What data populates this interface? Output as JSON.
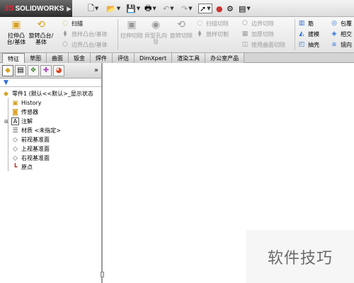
{
  "app": {
    "logo_text": "SOLIDWORKS",
    "logo_mark": "3S"
  },
  "ribbon": {
    "extrude_boss": "拉伸凸台/基体",
    "revolve_boss": "旋转凸台/基体",
    "sweep": "扫描",
    "loft": "放样凸台/基体",
    "boundary_boss": "边界凸台/基体",
    "extrude_cut": "拉伸切除",
    "hole_wizard": "异型孔向导",
    "revolve_cut": "旋转切除",
    "swept_cut": "扫描切除",
    "lofted_cut": "放样切割",
    "boundary_cut": "边界切除",
    "thicken_cut": "加厚切除",
    "surface_cut": "使用曲面切除",
    "rib": "筋",
    "draft": "拔模",
    "shell": "抽壳",
    "wrap": "包覆",
    "intersect": "相交",
    "mirror": "镜向"
  },
  "tabs": [
    "特征",
    "草图",
    "曲面",
    "钣金",
    "焊件",
    "评估",
    "DimXpert",
    "渲染工具",
    "办公室产品"
  ],
  "tree": {
    "root": "零件1 (默认<<默认>_显示状态",
    "history": "History",
    "sensors": "传感器",
    "annotations": "注解",
    "material": "材质 <未指定>",
    "front_plane": "前视基准面",
    "top_plane": "上视基准面",
    "right_plane": "右视基准面",
    "origin": "原点"
  },
  "watermark": "软件技巧",
  "colors": {
    "accent": "#2b6fd6",
    "logo_red": "#e22233"
  },
  "icons": {
    "panel_tabs": [
      "feature-manager-icon",
      "property-manager-icon",
      "configuration-manager-icon",
      "dimxpert-manager-icon",
      "display-manager-icon"
    ]
  }
}
